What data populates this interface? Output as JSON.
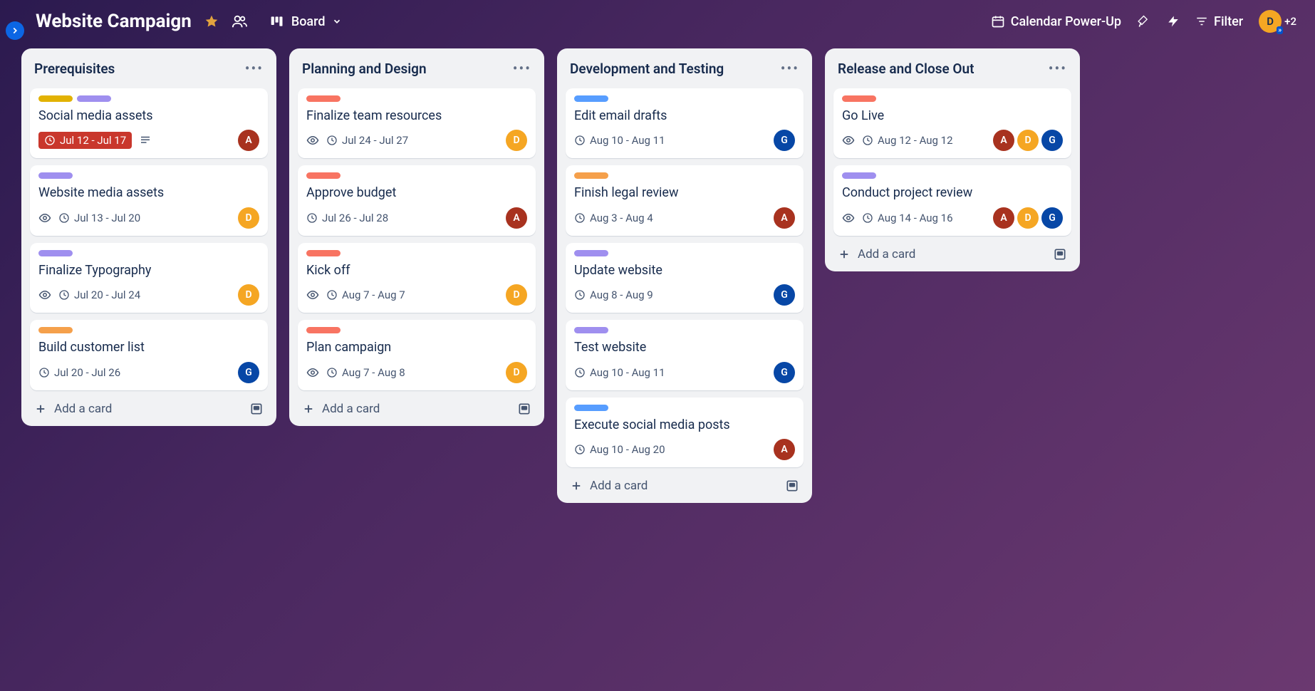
{
  "header": {
    "board_title": "Website Campaign",
    "view_label": "Board",
    "powerup_label": "Calendar Power-Up",
    "filter_label": "Filter",
    "extra_count": "+2",
    "user_initial": "D"
  },
  "add_card_label": "Add a card",
  "lists": [
    {
      "title": "Prerequisites",
      "cards": [
        {
          "labels": [
            "yellow",
            "purple"
          ],
          "title": "Social media assets",
          "watch": false,
          "date": "Jul 12 - Jul 17",
          "overdue": true,
          "desc": true,
          "members": [
            "A"
          ]
        },
        {
          "labels": [
            "purple"
          ],
          "title": "Website media assets",
          "watch": true,
          "date": "Jul 13 - Jul 20",
          "overdue": false,
          "desc": false,
          "members": [
            "D"
          ]
        },
        {
          "labels": [
            "purple"
          ],
          "title": "Finalize Typography",
          "watch": true,
          "date": "Jul 20 - Jul 24",
          "overdue": false,
          "desc": false,
          "members": [
            "D"
          ]
        },
        {
          "labels": [
            "orange"
          ],
          "title": "Build customer list",
          "watch": false,
          "date": "Jul 20 - Jul 26",
          "overdue": false,
          "desc": false,
          "members": [
            "G"
          ]
        }
      ]
    },
    {
      "title": "Planning and Design",
      "cards": [
        {
          "labels": [
            "red"
          ],
          "title": "Finalize team resources",
          "watch": true,
          "date": "Jul 24 - Jul 27",
          "overdue": false,
          "desc": false,
          "members": [
            "D"
          ]
        },
        {
          "labels": [
            "red"
          ],
          "title": "Approve budget",
          "watch": false,
          "date": "Jul 26 - Jul 28",
          "overdue": false,
          "desc": false,
          "members": [
            "A"
          ]
        },
        {
          "labels": [
            "red"
          ],
          "title": "Kick off",
          "watch": true,
          "date": "Aug 7 - Aug 7",
          "overdue": false,
          "desc": false,
          "members": [
            "D"
          ]
        },
        {
          "labels": [
            "red"
          ],
          "title": "Plan campaign",
          "watch": true,
          "date": "Aug 7 - Aug 8",
          "overdue": false,
          "desc": false,
          "members": [
            "D"
          ]
        }
      ]
    },
    {
      "title": "Development and Testing",
      "cards": [
        {
          "labels": [
            "blue"
          ],
          "title": "Edit email drafts",
          "watch": false,
          "date": "Aug 10 - Aug 11",
          "overdue": false,
          "desc": false,
          "members": [
            "G"
          ]
        },
        {
          "labels": [
            "orange"
          ],
          "title": "Finish legal review",
          "watch": false,
          "date": "Aug 3 - Aug 4",
          "overdue": false,
          "desc": false,
          "members": [
            "A"
          ]
        },
        {
          "labels": [
            "purple"
          ],
          "title": "Update website",
          "watch": false,
          "date": "Aug 8 - Aug 9",
          "overdue": false,
          "desc": false,
          "members": [
            "G"
          ]
        },
        {
          "labels": [
            "purple"
          ],
          "title": "Test website",
          "watch": false,
          "date": "Aug 10 - Aug 11",
          "overdue": false,
          "desc": false,
          "members": [
            "G"
          ]
        },
        {
          "labels": [
            "blue"
          ],
          "title": "Execute social media posts",
          "watch": false,
          "date": "Aug 10 - Aug 20",
          "overdue": false,
          "desc": false,
          "members": [
            "A"
          ]
        }
      ]
    },
    {
      "title": "Release and Close Out",
      "cards": [
        {
          "labels": [
            "red"
          ],
          "title": "Go Live",
          "watch": true,
          "date": "Aug 12 - Aug 12",
          "overdue": false,
          "desc": false,
          "members": [
            "A",
            "D",
            "G"
          ]
        },
        {
          "labels": [
            "purple"
          ],
          "title": "Conduct project review",
          "watch": true,
          "date": "Aug 14 - Aug 16",
          "overdue": false,
          "desc": false,
          "members": [
            "A",
            "D",
            "G"
          ]
        }
      ]
    }
  ]
}
